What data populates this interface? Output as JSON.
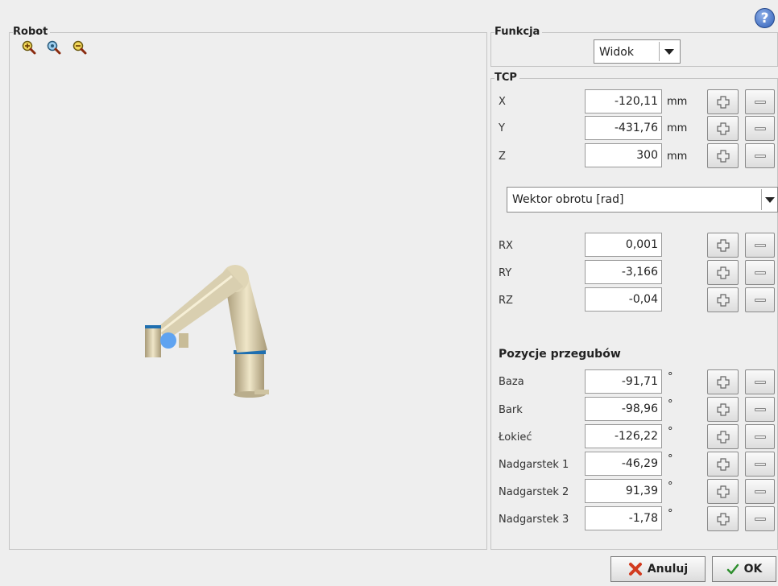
{
  "robot_panel": {
    "title": "Robot",
    "zoom_icons": [
      "zoom-in-icon",
      "zoom-reset-icon",
      "zoom-out-icon"
    ]
  },
  "funkcja_panel": {
    "title": "Funkcja",
    "dropdown_value": "Widok"
  },
  "tcp_panel": {
    "title": "TCP",
    "rows": [
      {
        "label": "X",
        "value": "-120,11",
        "unit": "mm"
      },
      {
        "label": "Y",
        "value": "-431,76",
        "unit": "mm"
      },
      {
        "label": "Z",
        "value": "300",
        "unit": "mm"
      }
    ],
    "rotation_dropdown": "Wektor obrotu [rad]",
    "rot_rows": [
      {
        "label": "RX",
        "value": "0,001"
      },
      {
        "label": "RY",
        "value": "-3,166"
      },
      {
        "label": "RZ",
        "value": "-0,04"
      }
    ]
  },
  "joints": {
    "title": "Pozycje przegubów",
    "unit": "°",
    "rows": [
      {
        "label": "Baza",
        "value": "-91,71"
      },
      {
        "label": "Bark",
        "value": "-98,96"
      },
      {
        "label": "Łokieć",
        "value": "-126,22"
      },
      {
        "label": "Nadgarstek 1",
        "value": "-46,29"
      },
      {
        "label": "Nadgarstek 2",
        "value": "91,39"
      },
      {
        "label": "Nadgarstek 3",
        "value": "-1,78"
      }
    ]
  },
  "footer": {
    "cancel_label": "Anuluj",
    "ok_label": "OK"
  },
  "help": {
    "label": "?"
  },
  "colors": {
    "accent_blue": "#5fa3f0",
    "robot_body": "#d9cfb0",
    "cancel_x": "#d23b1f",
    "ok_check": "#2f8f2f"
  }
}
